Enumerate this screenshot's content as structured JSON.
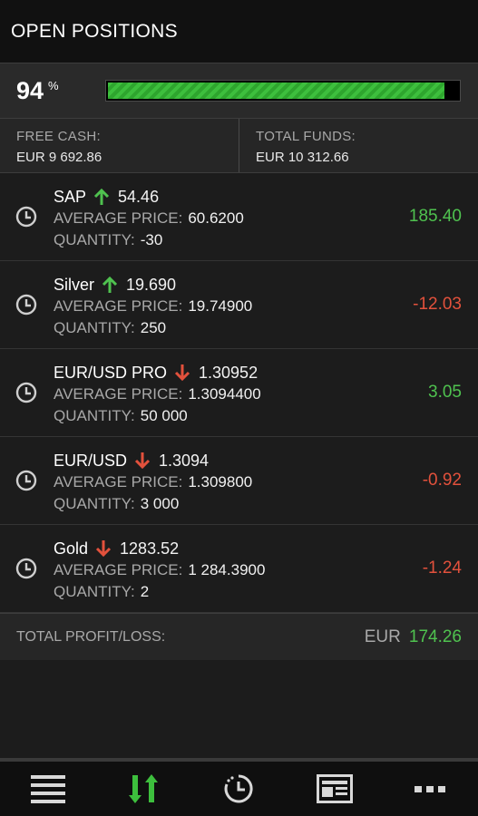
{
  "header": {
    "title": "OPEN POSITIONS"
  },
  "usage": {
    "percent": "94",
    "percent_symbol": "%",
    "bar_fill": 0.96
  },
  "funds": {
    "free_cash_label": "FREE CASH:",
    "free_cash_value": "EUR 9 692.86",
    "total_funds_label": "TOTAL FUNDS:",
    "total_funds_value": "EUR 10 312.66"
  },
  "labels": {
    "avg_price": "AVERAGE PRICE:",
    "quantity": "QUANTITY:"
  },
  "positions": [
    {
      "name": "SAP",
      "direction": "up",
      "price": "54.46",
      "avg_price": "60.6200",
      "quantity": "-30",
      "pl": "185.40",
      "pl_sign": "pos"
    },
    {
      "name": "Silver",
      "direction": "up",
      "price": "19.690",
      "avg_price": "19.74900",
      "quantity": "250",
      "pl": "-12.03",
      "pl_sign": "neg"
    },
    {
      "name": "EUR/USD PRO",
      "direction": "down",
      "price": "1.30952",
      "avg_price": "1.3094400",
      "quantity": "50 000",
      "pl": "3.05",
      "pl_sign": "pos"
    },
    {
      "name": "EUR/USD",
      "direction": "down",
      "price": "1.3094",
      "avg_price": "1.309800",
      "quantity": "3 000",
      "pl": "-0.92",
      "pl_sign": "neg"
    },
    {
      "name": "Gold",
      "direction": "down",
      "price": "1283.52",
      "avg_price": "1 284.3900",
      "quantity": "2",
      "pl": "-1.24",
      "pl_sign": "neg"
    }
  ],
  "total": {
    "label": "TOTAL PROFIT/LOSS:",
    "currency": "EUR",
    "value": "174.26"
  },
  "colors": {
    "positive": "#4fc24f",
    "negative": "#e2513c",
    "bar": "#3dbf3d",
    "active_nav": "#3dbf3d"
  },
  "bottom_nav": [
    {
      "icon": "menu-icon",
      "active": false
    },
    {
      "icon": "positions-arrows-icon",
      "active": true
    },
    {
      "icon": "history-clock-icon",
      "active": false
    },
    {
      "icon": "news-icon",
      "active": false
    },
    {
      "icon": "more-icon",
      "active": false
    }
  ]
}
